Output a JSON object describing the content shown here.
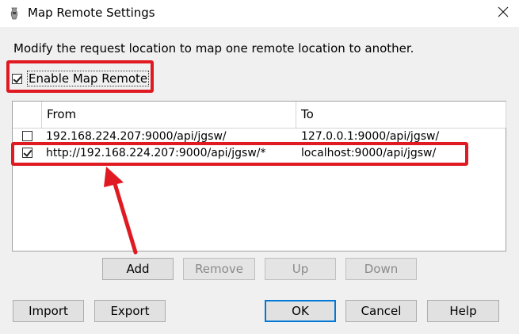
{
  "window": {
    "title": "Map Remote Settings",
    "app_icon": "charles-vase-icon",
    "close_icon": "close-icon"
  },
  "description": "Modify the request location to map one remote location to another.",
  "enable": {
    "label": "Enable Map Remote",
    "checked": true
  },
  "table": {
    "columns": [
      "From",
      "To"
    ],
    "rows": [
      {
        "checked": false,
        "from": "192.168.224.207:9000/api/jgsw/",
        "to": "127.0.0.1:9000/api/jgsw/"
      },
      {
        "checked": true,
        "from": "http://192.168.224.207:9000/api/jgsw/*",
        "to": "localhost:9000/api/jgsw/"
      }
    ]
  },
  "list_buttons": {
    "add": "Add",
    "remove": "Remove",
    "up": "Up",
    "down": "Down"
  },
  "footer_buttons": {
    "import": "Import",
    "export": "Export",
    "ok": "OK",
    "cancel": "Cancel",
    "help": "Help"
  },
  "annotation": {
    "highlight_color": "#e01a22",
    "arrow_icon": "red-arrow-icon"
  }
}
